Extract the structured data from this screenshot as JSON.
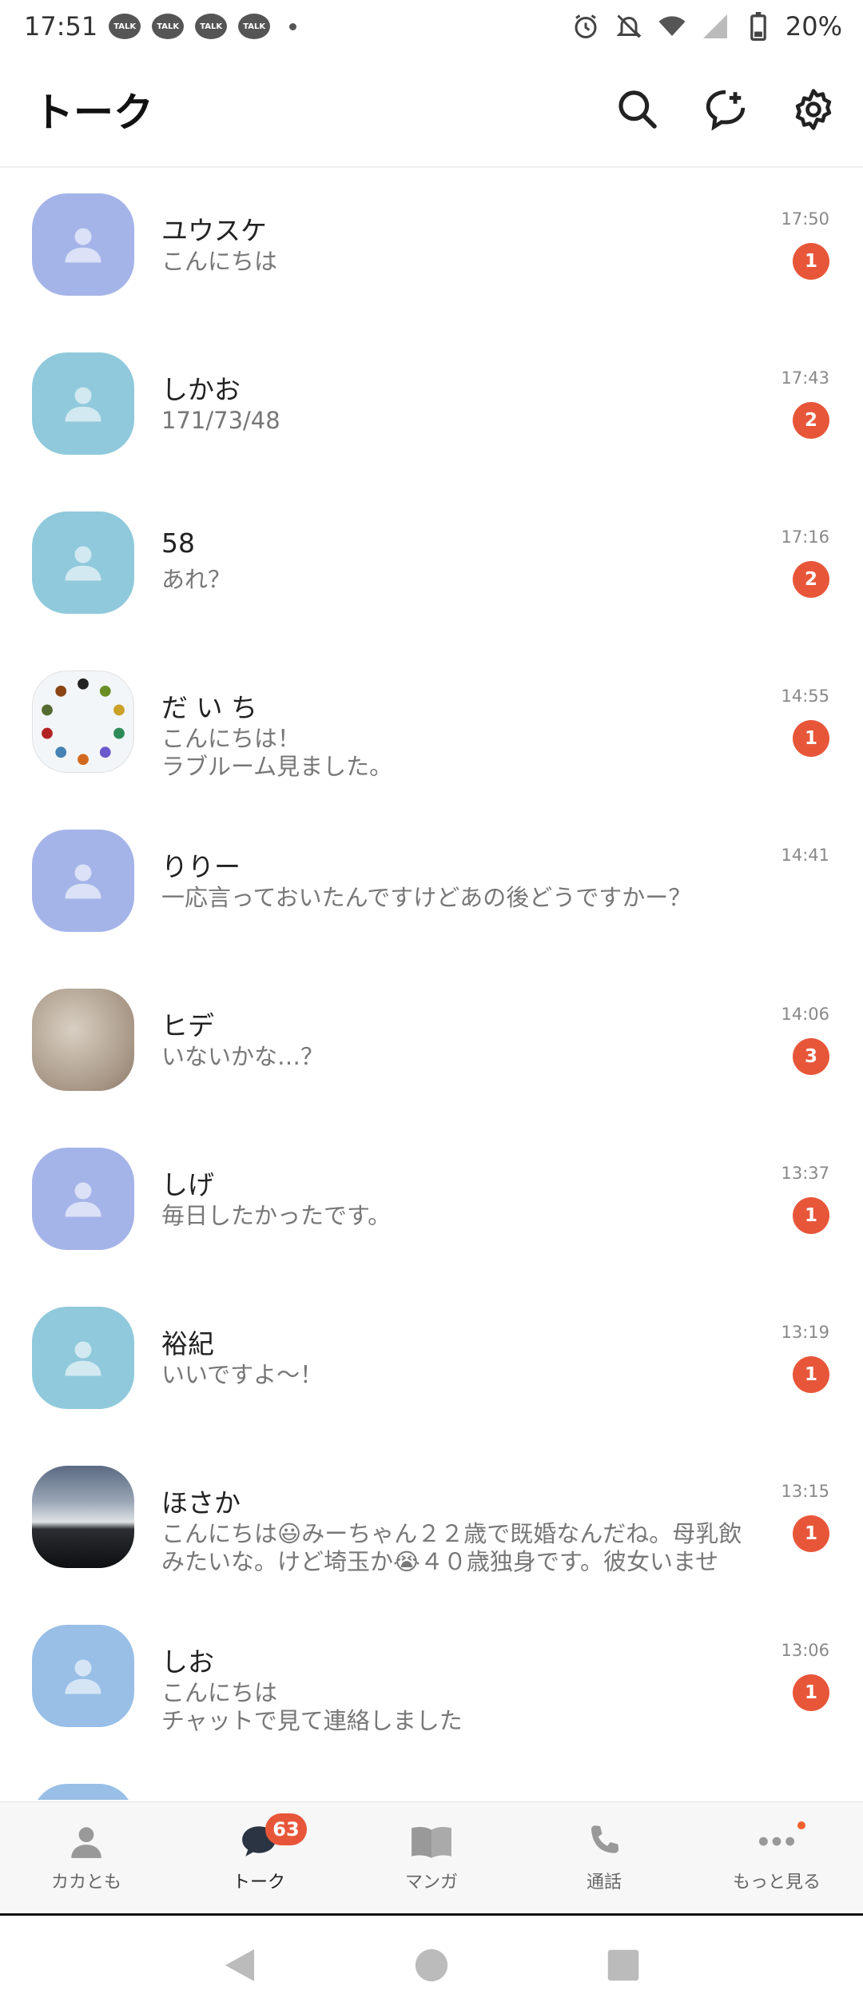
{
  "status_bar": {
    "time": "17:51",
    "talk_icon_label": "TALK",
    "battery": "20%"
  },
  "header": {
    "title": "トーク"
  },
  "chats": [
    {
      "name": "ユウスケ",
      "preview": "こんにちは",
      "time": "17:50",
      "unread": "1",
      "avatar": "purple"
    },
    {
      "name": "しかお",
      "preview": "171/73/48",
      "time": "17:43",
      "unread": "2",
      "avatar": "teal"
    },
    {
      "name": "58",
      "preview": "あれ？",
      "time": "17:16",
      "unread": "2",
      "avatar": "teal"
    },
    {
      "name": "だ い ち",
      "preview": "こんにちは！\nラブルーム見ました。",
      "time": "14:55",
      "unread": "1",
      "avatar": "clock"
    },
    {
      "name": "りりー",
      "preview": "一応言っておいたんですけどあの後どうですかー？",
      "time": "14:41",
      "unread": "",
      "avatar": "purple"
    },
    {
      "name": "ヒデ",
      "preview": "いないかな…？",
      "time": "14:06",
      "unread": "3",
      "avatar": "rock"
    },
    {
      "name": "しげ",
      "preview": "毎日したかったです。",
      "time": "13:37",
      "unread": "1",
      "avatar": "purple"
    },
    {
      "name": "裕紀",
      "preview": "いいですよ〜！",
      "time": "13:19",
      "unread": "1",
      "avatar": "teal"
    },
    {
      "name": "ほさか",
      "preview": "こんにちは😃みーちゃん２２歳で既婚なんだね。母乳飲\nみたいな。けど埼玉か😭４０歳独身です。彼女いませ",
      "time": "13:15",
      "unread": "1",
      "avatar": "sky"
    },
    {
      "name": "しお",
      "preview": "こんにちは\nチャットで見て連絡しました",
      "time": "13:06",
      "unread": "1",
      "avatar": "blue"
    },
    {
      "name": "",
      "preview": "",
      "time": "",
      "unread": "",
      "avatar": "blue"
    }
  ],
  "bottom_nav": {
    "friends_label": "カカとも",
    "talk_label": "トーク",
    "talk_badge": "63",
    "manga_label": "マンガ",
    "call_label": "通話",
    "more_label": "もっと見る"
  },
  "colors": {
    "badge": "#e8563a",
    "avatar_purple": "#a5b4e8",
    "avatar_teal": "#90c9dc",
    "avatar_blue": "#99bfe7"
  },
  "icons": [
    "search-icon",
    "new-chat-icon",
    "settings-icon",
    "person-icon",
    "chat-bubble-icon",
    "book-icon",
    "phone-icon",
    "more-dots-icon",
    "back-icon",
    "home-icon",
    "recents-icon"
  ]
}
